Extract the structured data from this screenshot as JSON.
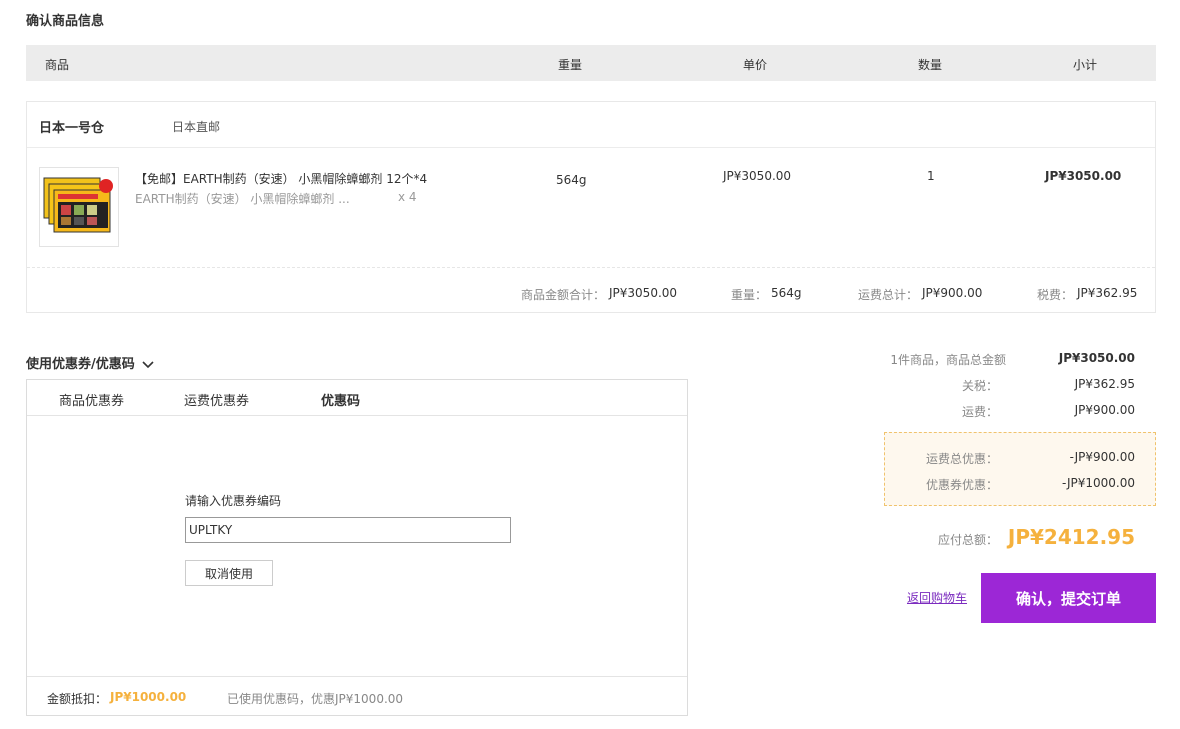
{
  "page": {
    "section_title": "确认商品信息"
  },
  "table_header": {
    "product": "商品",
    "weight": "重量",
    "unit_price": "单价",
    "quantity": "数量",
    "subtotal": "小计"
  },
  "warehouse": {
    "name": "日本一号仓",
    "type": "日本直邮"
  },
  "item": {
    "title": "【免邮】EARTH制药（安速） 小黑帽除蟑螂剂 12个*4",
    "subtitle": "EARTH制药（安速） 小黑帽除蟑螂剂 ...",
    "sub_qty": "x 4",
    "weight": "564g",
    "unit_price": "JP¥3050.00",
    "quantity": "1",
    "subtotal": "JP¥3050.00"
  },
  "order_summary": {
    "goods_total_label": "商品金额合计：",
    "goods_total_value": "JP¥3050.00",
    "weight_label": "重量：",
    "weight_value": "564g",
    "shipping_label": "运费总计：",
    "shipping_value": "JP¥900.00",
    "tax_label": "税费：",
    "tax_value": "JP¥362.95"
  },
  "coupon": {
    "title": "使用优惠券/优惠码",
    "tabs": [
      {
        "label": "商品优惠券"
      },
      {
        "label": "运费优惠券"
      },
      {
        "label": "优惠码"
      }
    ],
    "code_label": "请输入优惠券编码",
    "code_value": "UPLTKY",
    "cancel_label": "取消使用",
    "deduct_label": "金额抵扣：",
    "deduct_value": "JP¥1000.00",
    "used_note": "已使用优惠码，优惠JP¥1000.00"
  },
  "totals": {
    "items_label": "1件商品，商品总金额",
    "items_value": "JP¥3050.00",
    "duty_label": "关税：",
    "duty_value": "JP¥362.95",
    "shipping_label": "运费：",
    "shipping_value": "JP¥900.00",
    "shipping_discount_label": "运费总优惠：",
    "shipping_discount_value": "-JP¥900.00",
    "coupon_discount_label": "优惠券优惠：",
    "coupon_discount_value": "-JP¥1000.00",
    "payable_label": "应付总额：",
    "payable_value": "JP¥2412.95"
  },
  "actions": {
    "back_label": "返回购物车",
    "submit_label": "确认，提交订单"
  },
  "colors": {
    "accent_purple": "#9c27d6",
    "highlight_orange": "#f5b13d"
  }
}
